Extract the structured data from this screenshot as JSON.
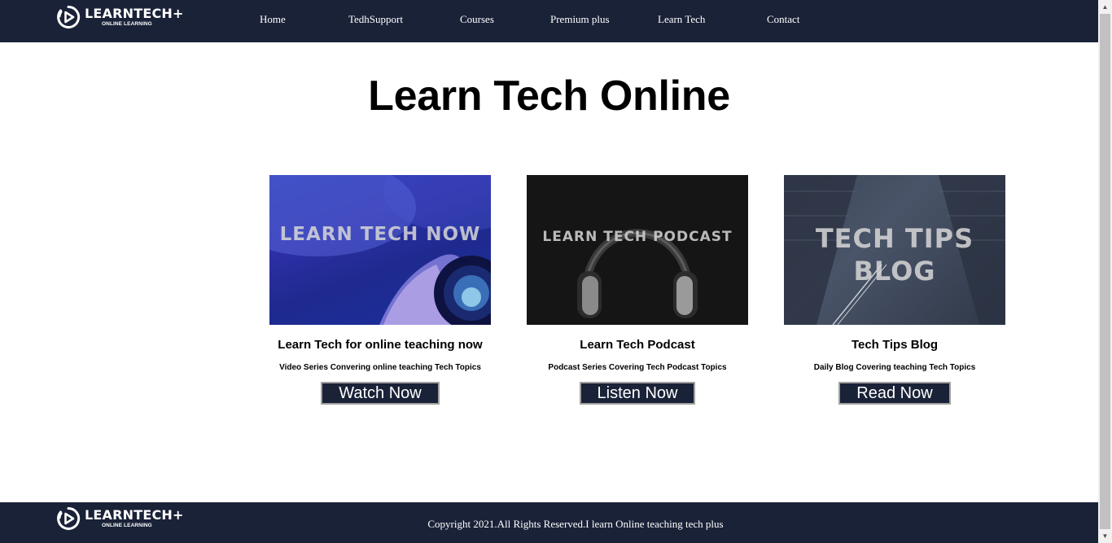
{
  "brand": {
    "name": "LEARNTECH+",
    "tagline": "ONLINE LEARNING"
  },
  "nav": {
    "items": [
      "Home",
      "TedhSupport",
      "Courses",
      "Premium plus",
      "Learn Tech",
      "Contact"
    ]
  },
  "main": {
    "title": "Learn Tech Online"
  },
  "cards": [
    {
      "image_text": "LEARN TECH NOW",
      "title": "Learn Tech for online teaching now",
      "description": "Video Series Convering online teaching Tech Topics",
      "button": "Watch Now"
    },
    {
      "image_text": "LEARN TECH PODCAST",
      "title": "Learn Tech Podcast",
      "description": "Podcast Series Covering Tech Podcast Topics",
      "button": "Listen Now"
    },
    {
      "image_text_line1": "TECH TIPS",
      "image_text_line2": "BLOG",
      "title": "Tech Tips Blog",
      "description": "Daily Blog Covering teaching Tech Topics",
      "button": "Read Now"
    }
  ],
  "footer": {
    "copyright": "Copyright 2021.All Rights Reserved.I learn Online teaching tech plus"
  },
  "colors": {
    "header_bg": "#1a2238",
    "button_bg": "#1a2238",
    "text": "#000000"
  }
}
